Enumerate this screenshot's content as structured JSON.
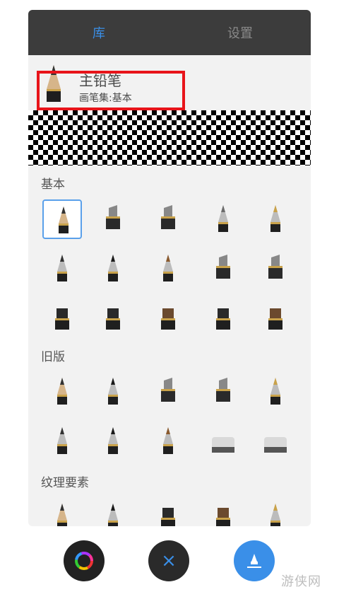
{
  "tabs": {
    "library": "库",
    "settings": "设置"
  },
  "current_brush": {
    "name": "主铅笔",
    "set": "画笔集:基本"
  },
  "sections": [
    {
      "title": "基本",
      "brushes": [
        "pencil-icon",
        "marker-chisel-icon",
        "marker-icon",
        "technical-pen-icon",
        "fountain-pen-icon",
        "round-brush-icon",
        "ink-brush-icon",
        "airbrush-icon",
        "wide-marker-icon",
        "felt-marker-icon",
        "block-brush-icon",
        "ragged-brush-icon",
        "bristle-brush-icon",
        "flat-brush-icon",
        "wide-bristle-brush-icon"
      ]
    },
    {
      "title": "旧版",
      "brushes": [
        "legacy-pencil-icon",
        "legacy-airbrush-icon",
        "legacy-marker-icon",
        "legacy-chisel-marker-icon",
        "legacy-pen-icon",
        "legacy-paintbrush-icon",
        "legacy-fine-brush-icon",
        "legacy-nib-icon",
        "legacy-eraser-icon",
        "legacy-soft-eraser-icon"
      ]
    },
    {
      "title": "纹理要素",
      "brushes": [
        "texture-pencil-icon",
        "texture-charcoal-icon",
        "texture-block-icon",
        "texture-bristle-icon",
        "texture-brush-icon"
      ]
    }
  ],
  "buttons": {
    "color": "color-wheel-icon",
    "close": "×",
    "brush": "brush-settings-icon"
  },
  "watermark": "游侠网",
  "colors": {
    "accent": "#3a8fe8",
    "tab_bar": "#3c3c3c",
    "highlight": "#e8141a"
  }
}
